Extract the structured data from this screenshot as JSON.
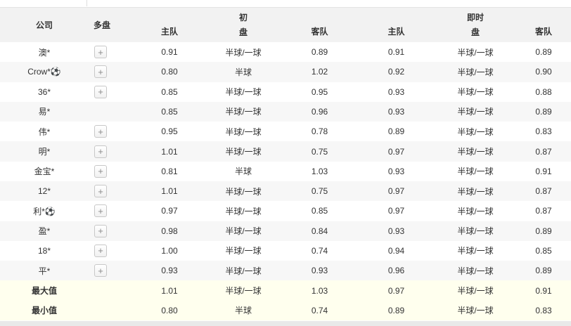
{
  "header": {
    "company": "公司",
    "multi": "多盘",
    "home": "主队",
    "away": "客队",
    "initial_group_line1": "初",
    "initial_group_line2": "盘",
    "live_group_line1": "即时",
    "live_group_line2": "盘"
  },
  "table": {
    "expand_label": "+",
    "rows": [
      {
        "company": "澳*",
        "has_expand": true,
        "summary": false,
        "init_home": "0.91",
        "init_handicap": "半球/一球",
        "init_away": "0.89",
        "live_home": "0.91",
        "live_handicap": "半球/一球",
        "live_away": "0.89"
      },
      {
        "company": "Crow*⚽",
        "has_expand": true,
        "summary": false,
        "init_home": "0.80",
        "init_handicap": "半球",
        "init_away": "1.02",
        "live_home": "0.92",
        "live_handicap": "半球/一球",
        "live_away": "0.90"
      },
      {
        "company": "36*",
        "has_expand": true,
        "summary": false,
        "init_home": "0.85",
        "init_handicap": "半球/一球",
        "init_away": "0.95",
        "live_home": "0.93",
        "live_handicap": "半球/一球",
        "live_away": "0.88"
      },
      {
        "company": "易*",
        "has_expand": false,
        "summary": false,
        "init_home": "0.85",
        "init_handicap": "半球/一球",
        "init_away": "0.96",
        "live_home": "0.93",
        "live_handicap": "半球/一球",
        "live_away": "0.89"
      },
      {
        "company": "伟*",
        "has_expand": true,
        "summary": false,
        "init_home": "0.95",
        "init_handicap": "半球/一球",
        "init_away": "0.78",
        "live_home": "0.89",
        "live_handicap": "半球/一球",
        "live_away": "0.83"
      },
      {
        "company": "明*",
        "has_expand": true,
        "summary": false,
        "init_home": "1.01",
        "init_handicap": "半球/一球",
        "init_away": "0.75",
        "live_home": "0.97",
        "live_handicap": "半球/一球",
        "live_away": "0.87"
      },
      {
        "company": "金宝*",
        "has_expand": true,
        "summary": false,
        "init_home": "0.81",
        "init_handicap": "半球",
        "init_away": "1.03",
        "live_home": "0.93",
        "live_handicap": "半球/一球",
        "live_away": "0.91"
      },
      {
        "company": "12*",
        "has_expand": true,
        "summary": false,
        "init_home": "1.01",
        "init_handicap": "半球/一球",
        "init_away": "0.75",
        "live_home": "0.97",
        "live_handicap": "半球/一球",
        "live_away": "0.87"
      },
      {
        "company": "利*⚽",
        "has_expand": true,
        "summary": false,
        "init_home": "0.97",
        "init_handicap": "半球/一球",
        "init_away": "0.85",
        "live_home": "0.97",
        "live_handicap": "半球/一球",
        "live_away": "0.87"
      },
      {
        "company": "盈*",
        "has_expand": true,
        "summary": false,
        "init_home": "0.98",
        "init_handicap": "半球/一球",
        "init_away": "0.84",
        "live_home": "0.93",
        "live_handicap": "半球/一球",
        "live_away": "0.89"
      },
      {
        "company": "18*",
        "has_expand": true,
        "summary": false,
        "init_home": "1.00",
        "init_handicap": "半球/一球",
        "init_away": "0.74",
        "live_home": "0.94",
        "live_handicap": "半球/一球",
        "live_away": "0.85"
      },
      {
        "company": "平*",
        "has_expand": true,
        "summary": false,
        "init_home": "0.93",
        "init_handicap": "半球/一球",
        "init_away": "0.93",
        "live_home": "0.96",
        "live_handicap": "半球/一球",
        "live_away": "0.89"
      },
      {
        "company": "最大值",
        "has_expand": false,
        "summary": true,
        "init_home": "1.01",
        "init_handicap": "半球/一球",
        "init_away": "1.03",
        "live_home": "0.97",
        "live_handicap": "半球/一球",
        "live_away": "0.91"
      },
      {
        "company": "最小值",
        "has_expand": false,
        "summary": true,
        "init_home": "0.80",
        "init_handicap": "半球",
        "init_away": "0.74",
        "live_home": "0.89",
        "live_handicap": "半球/一球",
        "live_away": "0.83"
      }
    ]
  },
  "colors": {
    "header_bg": "#f2f2f2",
    "alt_row_bg": "#f7f7f7",
    "summary_row_bg": "#ffffee",
    "text": "#333333"
  }
}
